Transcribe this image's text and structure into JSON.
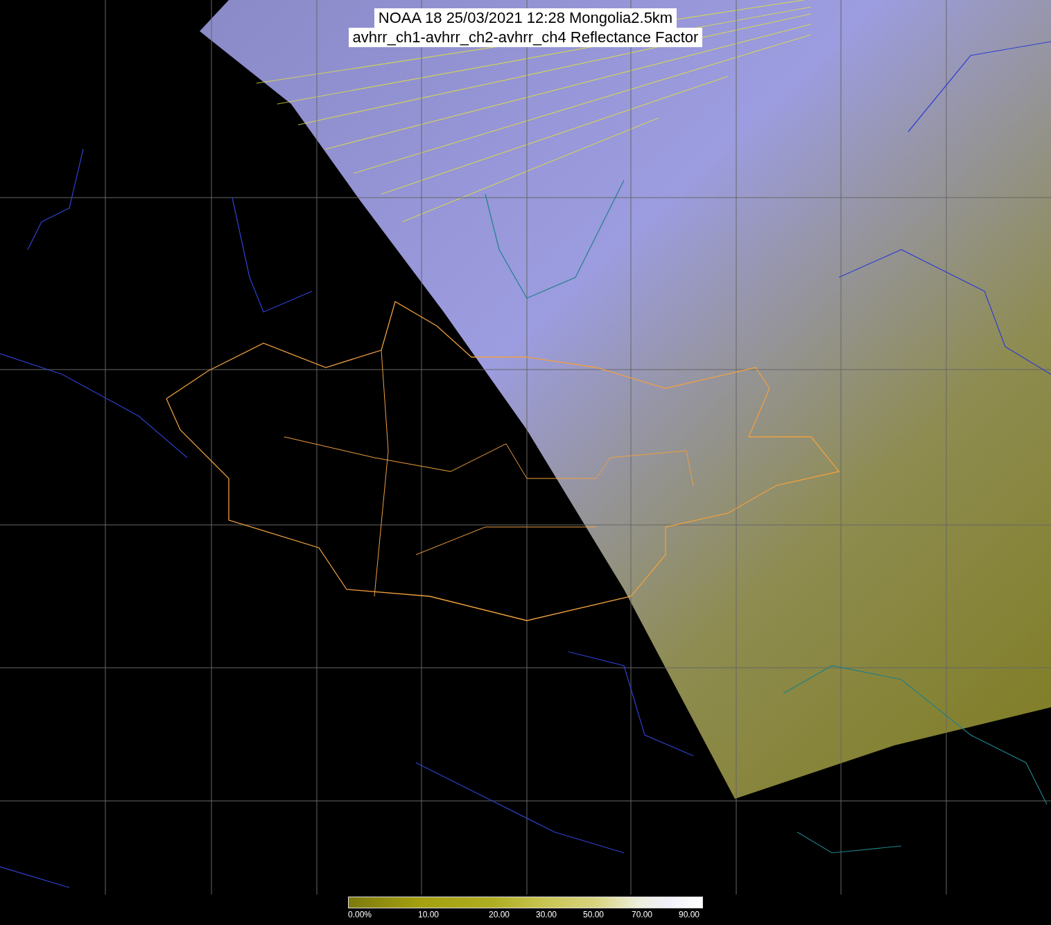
{
  "title": {
    "lines": [
      "NOAA 18 25/03/2021 12:28 Mongolia2.5km",
      "avhrr_ch1-avhrr_ch2-avhrr_ch4 Reflectance Factor"
    ]
  },
  "legend": {
    "labels": [
      "0.00%",
      "10.00",
      "20.00",
      "30.00",
      "50.00",
      "70.00",
      "90.00"
    ]
  }
}
